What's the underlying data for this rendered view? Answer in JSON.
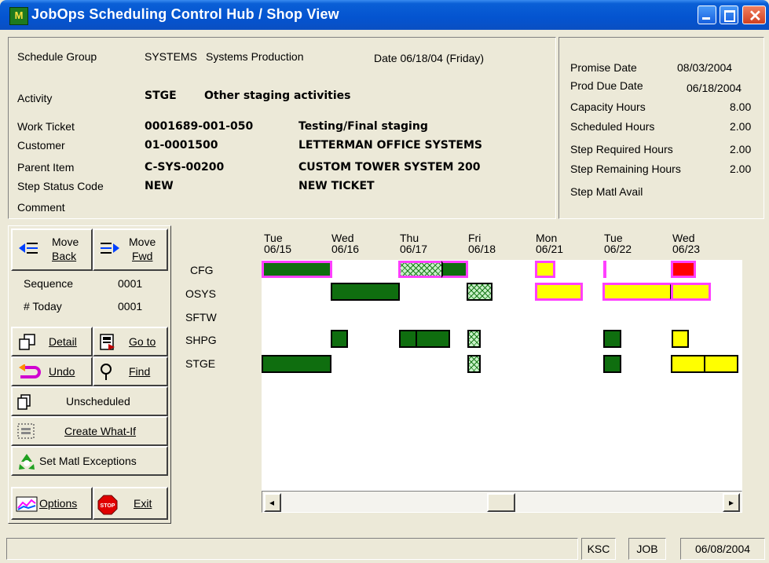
{
  "window": {
    "title": "JobOps Scheduling Control Hub / Shop View",
    "app_icon_text": "M"
  },
  "info": {
    "schedule_group_label": "Schedule Group",
    "schedule_group_code": "SYSTEMS",
    "schedule_group_name": "Systems Production",
    "date_text": "Date 06/18/04 (Friday)",
    "activity_label": "Activity",
    "activity_code": "STGE",
    "activity_desc": "Other staging activities",
    "work_ticket_label": "Work Ticket",
    "work_ticket_value": "0001689-001-050",
    "work_ticket_desc": "Testing/Final staging",
    "customer_label": "Customer",
    "customer_value": "01-0001500",
    "customer_name": "LETTERMAN OFFICE SYSTEMS",
    "parent_item_label": "Parent Item",
    "parent_item_value": "C-SYS-00200",
    "parent_item_desc": "CUSTOM TOWER SYSTEM 200",
    "step_status_label": "Step  Status Code",
    "step_status_value": "NEW",
    "step_status_desc": "NEW TICKET",
    "comment_label": "Comment"
  },
  "hours": {
    "promise_date_label": "Promise Date",
    "promise_date": "08/03/2004",
    "prod_due_label": "Prod Due Date",
    "prod_due": "06/18/2004",
    "capacity_label": "Capacity Hours",
    "capacity": "8.00",
    "scheduled_label": "Scheduled Hours",
    "scheduled": "2.00",
    "required_label": "Step Required Hours",
    "required": "2.00",
    "remaining_label": "Step Remaining Hours",
    "remaining": "2.00",
    "matl_label": "Step Matl Avail"
  },
  "controls": {
    "move_back_1": "Move",
    "move_back_2": "Back",
    "move_fwd_1": "Move",
    "move_fwd_2": "Fwd",
    "sequence_label": "Sequence",
    "sequence_value": "0001",
    "today_label": "# Today",
    "today_value": "0001",
    "detail": "Detail",
    "goto": "Go to",
    "undo": "Undo",
    "find": "Find",
    "unscheduled": "Unscheduled",
    "create_what_if": "Create What-If",
    "set_matl": "Set Matl Exceptions",
    "options": "Options",
    "exit": "Exit"
  },
  "gantt": {
    "days": [
      {
        "dow": "Tue",
        "date": "06/15"
      },
      {
        "dow": "Wed",
        "date": "06/16"
      },
      {
        "dow": "Thu",
        "date": "06/17"
      },
      {
        "dow": "Fri",
        "date": "06/18"
      },
      {
        "dow": "Mon",
        "date": "06/21"
      },
      {
        "dow": "Tue",
        "date": "06/22"
      },
      {
        "dow": "Wed",
        "date": "06/23"
      }
    ],
    "resources": [
      "CFG",
      "OSYS",
      "SFTW",
      "SHPG",
      "STGE"
    ]
  },
  "status": {
    "pane1": "",
    "pane2": "KSC",
    "pane3": "JOB",
    "pane4": "06/08/2004"
  },
  "colors": {
    "scheduled_green": "#0f6e0f",
    "late_yellow": "#ffff00",
    "overdue_red": "#ff0000",
    "highlight_magenta": "#ff40ff"
  }
}
